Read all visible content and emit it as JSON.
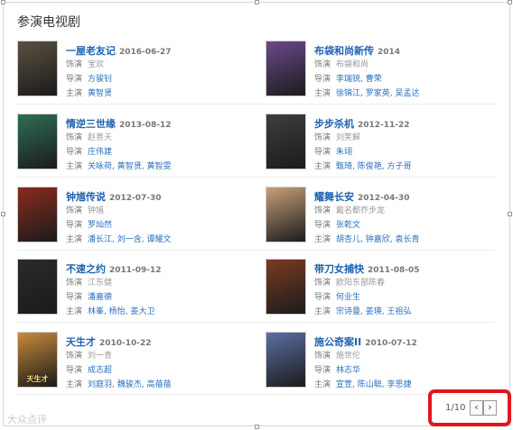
{
  "section_title": "参演电视剧",
  "labels": {
    "actor": "饰演",
    "director": "导演",
    "cast": "主演"
  },
  "dramas": [
    {
      "title": "一屋老友记",
      "date": "2016-06-27",
      "role": "宝欢",
      "director": "方骏钊",
      "cast": "黄智贤",
      "poster_color": "#5a5040",
      "poster_text": ""
    },
    {
      "title": "布袋和尚新传",
      "date": "2014",
      "role": "布袋和尚",
      "director": "李瑞锐, 曹荣",
      "cast": "徐锦江, 罗家英, 吴孟达",
      "poster_color": "#6b4a8c",
      "poster_text": ""
    },
    {
      "title": "情逆三世缘",
      "date": "2013-08-12",
      "role": "赵善天",
      "director": "庄伟建",
      "cast": "关咏荷, 黄智贤, 黄智雯",
      "poster_color": "#2f6e55",
      "poster_text": ""
    },
    {
      "title": "步步杀机",
      "date": "2012-11-22",
      "role": "刘笑解",
      "director": "朱翊",
      "cast": "甄琦, 陈俊艳, 方子哥",
      "poster_color": "#3b3f3a",
      "poster_text": ""
    },
    {
      "title": "钟馗传说",
      "date": "2012-07-30",
      "role": "钟馗",
      "director": "罗灿然",
      "cast": "潘长江, 刘一含, 谭耀文",
      "poster_color": "#8a2a1f",
      "poster_text": ""
    },
    {
      "title": "耀舞长安",
      "date": "2012-04-30",
      "role": "戴名都乔步龙",
      "director": "张乾文",
      "cast": "胡杏儿, 钟嘉欣, 袁长青",
      "poster_color": "#c7a07a",
      "poster_text": ""
    },
    {
      "title": "不速之约",
      "date": "2011-09-12",
      "role": "江东健",
      "director": "潘嘉德",
      "cast": "林峯, 杨怡, 姜大卫",
      "poster_color": "#2a2a2a",
      "poster_text": ""
    },
    {
      "title": "带刀女捕快",
      "date": "2011-08-05",
      "role": "欧阳东部陈春",
      "director": "何业生",
      "cast": "宗诗曼, 姜瑛, 王祖弘",
      "poster_color": "#7a3b22",
      "poster_text": ""
    },
    {
      "title": "天生才",
      "date": "2010-10-22",
      "role": "刘一青",
      "director": "成志超",
      "cast": "刘庭羽, 魏骏杰, 高蓓蓓",
      "poster_color": "#c98a3a",
      "poster_text": "天生才"
    },
    {
      "title": "施公奇案II",
      "date": "2010-07-12",
      "role": "施世伦",
      "director": "林志华",
      "cast": "宣萱, 陈山聪, 李思捷",
      "poster_color": "#5b6fa0",
      "poster_text": ""
    }
  ],
  "pagination": {
    "text": "1/10",
    "prev": "‹",
    "next": "›"
  },
  "watermark": "大众点评",
  "colors": {
    "accent": "#e1161f",
    "link": "#1e62b0"
  }
}
